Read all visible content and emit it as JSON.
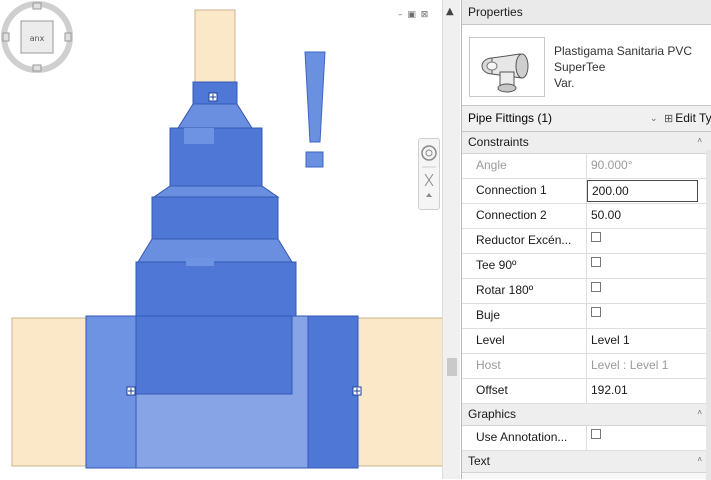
{
  "canvas": {
    "window_controls": "– ▣ ⊠",
    "scroll_up_glyph": "▲",
    "colors": {
      "pipe": "#fbe8c8",
      "fitting": "#4f78d6",
      "fitting_light": "#86a4e6",
      "warning": "#6a90e0"
    },
    "view_cube_label": "anx",
    "icons": [
      "view-cube-icon",
      "steering-wheel-icon",
      "zoom-icon",
      "warning-exclamation-icon",
      "connector-grip-icon"
    ]
  },
  "properties": {
    "title": "Properties",
    "type_name_lines": [
      "Plastigama Sanitaria PVC",
      "SuperTee",
      "Var."
    ],
    "selector": {
      "label": "Pipe Fittings (1)",
      "caret": "⌄",
      "edit_type_icon": "⊞",
      "edit_type": "Edit Typ"
    },
    "groups": [
      {
        "name": "Constraints",
        "toggle": "˄",
        "rows": [
          {
            "name": "Angle",
            "value": "90.000°",
            "readonly": true
          },
          {
            "name": "Connection 1",
            "value": "200.00",
            "active": true
          },
          {
            "name": "Connection 2",
            "value": "50.00"
          },
          {
            "name": "Reductor Excén...",
            "checkbox": true
          },
          {
            "name": "Tee 90º",
            "checkbox": true
          },
          {
            "name": "Rotar 180º",
            "checkbox": true
          },
          {
            "name": "Buje",
            "checkbox": true
          },
          {
            "name": "Level",
            "value": "Level 1"
          },
          {
            "name": "Host",
            "value": "Level : Level 1",
            "readonly": true
          },
          {
            "name": "Offset",
            "value": "192.01"
          }
        ]
      },
      {
        "name": "Graphics",
        "toggle": "˄",
        "rows": [
          {
            "name": "Use Annotation...",
            "checkbox": true
          }
        ]
      },
      {
        "name": "Text",
        "toggle": "˄",
        "rows": []
      }
    ]
  }
}
